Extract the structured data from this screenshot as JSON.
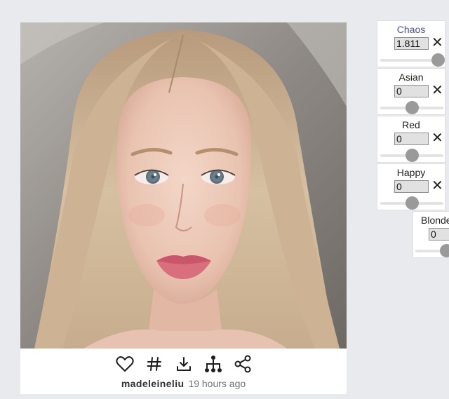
{
  "post": {
    "username": "madeleineliu",
    "timestamp": "19 hours ago"
  },
  "actions": {
    "like_icon": "heart-icon",
    "hashtag_icon": "hashtag-icon",
    "download_icon": "download-icon",
    "lineage_icon": "tree-icon",
    "share_icon": "share-icon"
  },
  "sliders": [
    {
      "label": "Chaos",
      "value": "1.811",
      "level": 1.0
    },
    {
      "label": "Asian",
      "value": "0",
      "level": 0.5
    },
    {
      "label": "Red",
      "value": "0",
      "level": 0.5
    },
    {
      "label": "Happy",
      "value": "0",
      "level": 0.5
    },
    {
      "label": "Blonde",
      "value": "0",
      "level": 0.5
    }
  ],
  "colors": {
    "background": "#e9eaee",
    "accent_label": "#4a4f9c",
    "knob": "#9a9a9a"
  }
}
